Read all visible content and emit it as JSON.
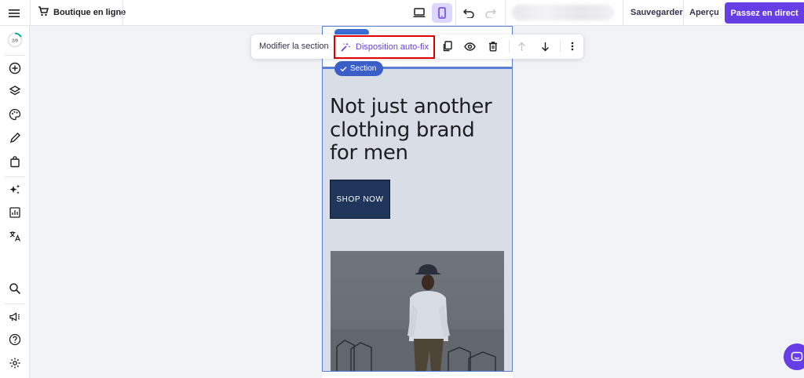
{
  "topbar": {
    "store_name": "Boutique en ligne",
    "save_label": "Sauvegarder",
    "preview_label": "Aperçu",
    "golive_label": "Passez en direct"
  },
  "sidebar": {
    "progress_text": "2/9"
  },
  "toolbar": {
    "edit_section_label": "Modifier la section",
    "autofix_label": "Disposition auto-fix"
  },
  "preview": {
    "section_tag": "Section",
    "heading": "Not just another clothing brand for men",
    "cta_label": "SHOP NOW"
  },
  "colors": {
    "accent": "#673de6",
    "section_bg": "#d8dde6",
    "cta_bg": "#1f3559",
    "highlight": "#e00000"
  }
}
